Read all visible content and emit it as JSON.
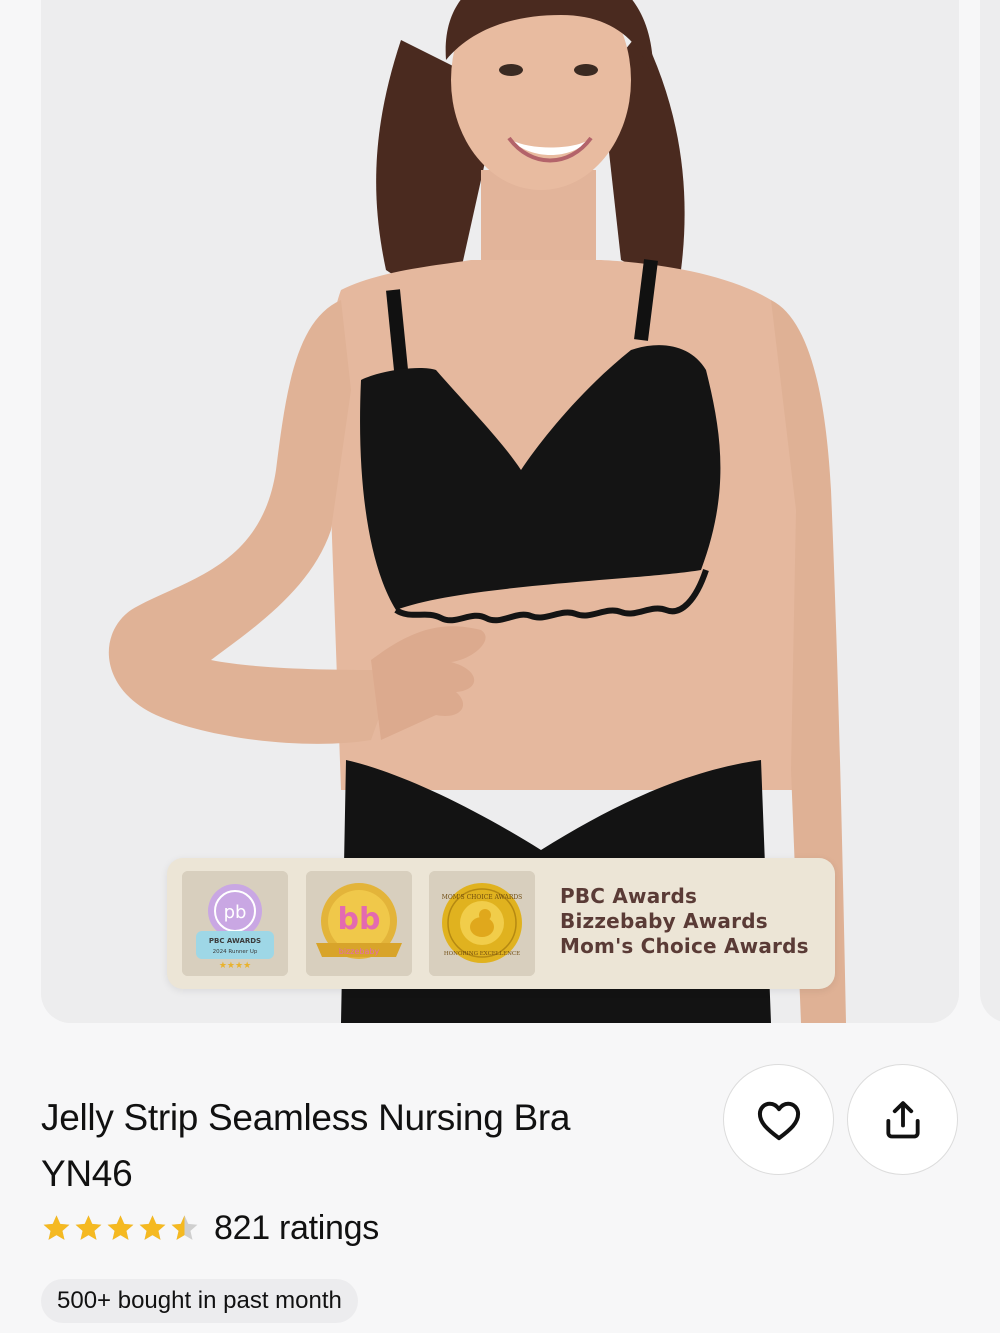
{
  "gallery": {
    "image_alt": "Model wearing black Jelly Strip Seamless Nursing Bra",
    "awards": {
      "tiles": [
        {
          "name": "PBC Awards badge",
          "logo_text": "pb",
          "caption_line1": "PBC AWARDS",
          "caption_line2": "2024 Runner Up"
        },
        {
          "name": "Bizzebaby Awards badge",
          "logo_text": "bb",
          "caption": "bizzebaby"
        },
        {
          "name": "Mom's Choice Awards badge",
          "ring_text": "MOM'S CHOICE AWARDS",
          "bottom_text": "HONORING EXCELLENCE"
        }
      ],
      "lines": [
        "PBC Awards",
        "Bizzebaby Awards",
        "Mom's Choice Awards"
      ]
    }
  },
  "product": {
    "title_line1": "Jelly Strip Seamless Nursing Bra",
    "title_line2": "YN46",
    "rating": 4.5,
    "rating_max": 5,
    "ratings_count": "821 ratings",
    "bought_badge": "500+ bought in past month"
  },
  "actions": {
    "favorite_icon": "heart-icon",
    "share_icon": "share-icon"
  },
  "colors": {
    "star": "#f5b921",
    "star_empty": "#cfcfcf",
    "award_text": "#5a3b36",
    "banner_bg": "#ece5d6"
  }
}
